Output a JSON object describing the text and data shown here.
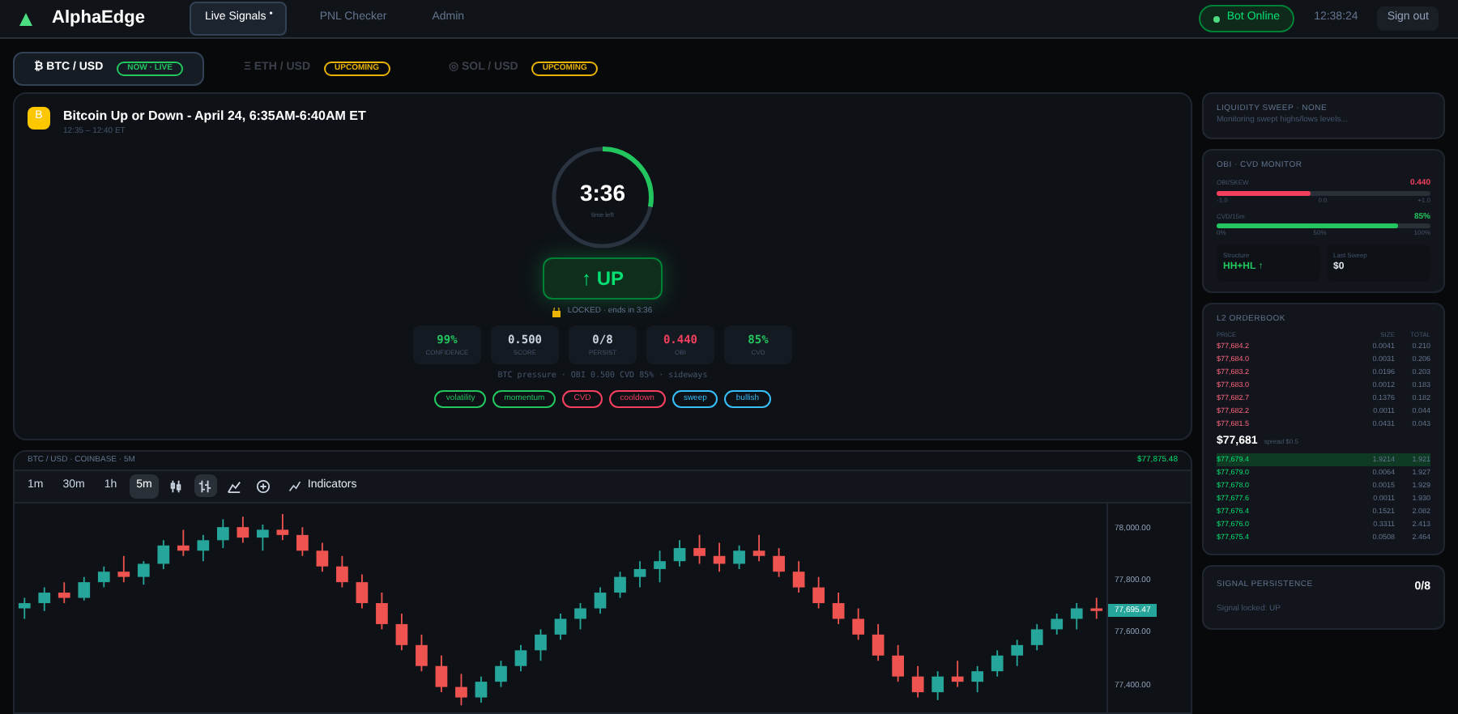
{
  "header": {
    "logo": "AlphaEdge",
    "nav": [
      {
        "label": "Live Signals",
        "selected": true,
        "badge": "•"
      },
      {
        "label": "PNL Checker",
        "selected": false
      },
      {
        "label": "Admin",
        "selected": false
      }
    ],
    "status": "Bot Online",
    "clock": "12:38:24",
    "sign_out": "Sign out"
  },
  "markets": [
    {
      "label": "₿ BTC / USD",
      "badge": "NOW · LIVE",
      "selected": true,
      "color": "#22c55e"
    },
    {
      "label": "Ξ ETH / USD",
      "badge": "UPCOMING",
      "selected": false,
      "color": "#eab308"
    },
    {
      "label": "◎ SOL / USD",
      "badge": "UPCOMING",
      "selected": false,
      "color": "#eab308"
    }
  ],
  "event": {
    "icon": "B",
    "title": "Bitcoin Up or Down - April 24, 6:35AM-6:40AM ET",
    "subtitle": "12:35 – 12:40 ET",
    "timer": "3:36",
    "timer_label": "time left",
    "level": 0.28,
    "signal": "↑ UP",
    "lock": "LOCKED · ends in 3:36",
    "stats": [
      {
        "value": "99%",
        "label": "CONFIDENCE",
        "color": "#22c55e"
      },
      {
        "value": "0.500",
        "label": "SCORE",
        "color": "#cbd5e1"
      },
      {
        "value": "0/8",
        "label": "PERSIST",
        "color": "#cbd5e1"
      },
      {
        "value": "0.440",
        "label": "OBI",
        "color": "#f43f5e"
      },
      {
        "value": "85%",
        "label": "CVD",
        "color": "#22c55e"
      }
    ],
    "pressure": "BTC pressure · OBI 0.500 CVD 85% · sideways",
    "tags": [
      {
        "label": "volatility",
        "color": "#22c55e"
      },
      {
        "label": "momentum",
        "color": "#22c55e"
      },
      {
        "label": "CVD",
        "color": "#f43f5e"
      },
      {
        "label": "cooldown",
        "color": "#f43f5e"
      },
      {
        "label": "sweep",
        "color": "#38bdf8"
      },
      {
        "label": "bullish",
        "color": "#38bdf8"
      }
    ]
  },
  "chart": {
    "price": "$77,875.48",
    "intervals": [
      {
        "label": "1m",
        "selected": false
      },
      {
        "label": "30m",
        "selected": false
      },
      {
        "label": "1h",
        "selected": false
      },
      {
        "label": "5m",
        "selected": true
      }
    ],
    "indicators": "Indicators",
    "chart_data": {
      "type": "candlestick",
      "title": "BTC / USD · COINBASE · 5M",
      "ohlc": [
        [
          77700,
          77740,
          77660,
          77720
        ],
        [
          77720,
          77780,
          77690,
          77760
        ],
        [
          77760,
          77800,
          77720,
          77740
        ],
        [
          77740,
          77820,
          77730,
          77800
        ],
        [
          77800,
          77860,
          77780,
          77840
        ],
        [
          77840,
          77900,
          77800,
          77820
        ],
        [
          77820,
          77880,
          77790,
          77870
        ],
        [
          77870,
          77960,
          77850,
          77940
        ],
        [
          77940,
          78000,
          77900,
          77920
        ],
        [
          77920,
          77980,
          77880,
          77960
        ],
        [
          77960,
          78040,
          77930,
          78010
        ],
        [
          78010,
          78050,
          77950,
          77970
        ],
        [
          77970,
          78020,
          77920,
          78000
        ],
        [
          78000,
          78060,
          77960,
          77980
        ],
        [
          77980,
          78010,
          77900,
          77920
        ],
        [
          77920,
          77950,
          77840,
          77860
        ],
        [
          77860,
          77900,
          77780,
          77800
        ],
        [
          77800,
          77830,
          77700,
          77720
        ],
        [
          77720,
          77760,
          77620,
          77640
        ],
        [
          77640,
          77680,
          77540,
          77560
        ],
        [
          77560,
          77600,
          77460,
          77480
        ],
        [
          77480,
          77520,
          77380,
          77400
        ],
        [
          77400,
          77450,
          77330,
          77360
        ],
        [
          77360,
          77440,
          77340,
          77420
        ],
        [
          77420,
          77500,
          77400,
          77480
        ],
        [
          77480,
          77560,
          77460,
          77540
        ],
        [
          77540,
          77620,
          77500,
          77600
        ],
        [
          77600,
          77680,
          77580,
          77660
        ],
        [
          77660,
          77720,
          77620,
          77700
        ],
        [
          77700,
          77780,
          77680,
          77760
        ],
        [
          77760,
          77840,
          77740,
          77820
        ],
        [
          77820,
          77880,
          77780,
          77850
        ],
        [
          77850,
          77920,
          77800,
          77880
        ],
        [
          77880,
          77960,
          77860,
          77930
        ],
        [
          77930,
          77980,
          77870,
          77900
        ],
        [
          77900,
          77950,
          77840,
          77870
        ],
        [
          77870,
          77940,
          77850,
          77920
        ],
        [
          77920,
          77980,
          77880,
          77900
        ],
        [
          77900,
          77930,
          77820,
          77840
        ],
        [
          77840,
          77880,
          77760,
          77780
        ],
        [
          77780,
          77820,
          77700,
          77720
        ],
        [
          77720,
          77760,
          77640,
          77660
        ],
        [
          77660,
          77700,
          77580,
          77600
        ],
        [
          77600,
          77640,
          77500,
          77520
        ],
        [
          77520,
          77560,
          77420,
          77440
        ],
        [
          77440,
          77480,
          77360,
          77380
        ],
        [
          77380,
          77460,
          77350,
          77440
        ],
        [
          77440,
          77500,
          77400,
          77420
        ],
        [
          77420,
          77480,
          77380,
          77460
        ],
        [
          77460,
          77540,
          77440,
          77520
        ],
        [
          77520,
          77580,
          77480,
          77560
        ],
        [
          77560,
          77640,
          77540,
          77620
        ],
        [
          77620,
          77680,
          77600,
          77660
        ],
        [
          77660,
          77720,
          77620,
          77700
        ],
        [
          77700,
          77740,
          77660,
          77690
        ]
      ],
      "ylim": [
        77300,
        78100
      ],
      "yticks": [
        {
          "value": 78000,
          "label": "78,000.00"
        },
        {
          "value": 77800,
          "label": "77,800.00"
        },
        {
          "value": 77600,
          "label": "77,600.00"
        },
        {
          "value": 77400,
          "label": "77,400.00"
        }
      ],
      "annotations": [
        "77,695.47"
      ]
    }
  },
  "liquidity": {
    "title": "LIQUIDITY SWEEP · NONE",
    "text": "Monitoring swept highs/lows levels..."
  },
  "monitor": {
    "title": "OBI · CVD MONITOR",
    "bars": [
      {
        "label": "OBI/SKEW",
        "reading": "0.440",
        "level": 0.44,
        "color": "#f43f5e",
        "ticks": [
          "-1.0",
          "0.0",
          "+1.0"
        ]
      },
      {
        "label": "CVD/15m",
        "reading": "85%",
        "level": 0.85,
        "color": "#22c55e",
        "ticks": [
          "0%",
          "50%",
          "100%"
        ]
      }
    ],
    "boxes": [
      {
        "label": "Structure",
        "value": "HH+HL ↑",
        "color": "#22c55e"
      },
      {
        "label": "Last Sweep",
        "value": "$0",
        "color": "#e2e8f0"
      }
    ]
  },
  "orderbook": {
    "title": "L2 ORDERBOOK",
    "columns": [
      "PRICE",
      "SIZE",
      "TOTAL"
    ],
    "asks": [
      [
        "$77,684.2",
        "0.0041",
        "0.210"
      ],
      [
        "$77,684.0",
        "0.0031",
        "0.206"
      ],
      [
        "$77,683.2",
        "0.0196",
        "0.203"
      ],
      [
        "$77,683.0",
        "0.0012",
        "0.183"
      ],
      [
        "$77,682.7",
        "0.1376",
        "0.182"
      ],
      [
        "$77,682.2",
        "0.0011",
        "0.044"
      ],
      [
        "$77,681.5",
        "0.0431",
        "0.043"
      ]
    ],
    "mid": "$77,681",
    "spread": "spread $0.5",
    "bids": [
      {
        "cells": [
          "$77,679.4",
          "1.9214",
          "1.921"
        ],
        "selected": true
      },
      {
        "cells": [
          "$77,679.0",
          "0.0064",
          "1.927"
        ],
        "selected": false
      },
      {
        "cells": [
          "$77,678.0",
          "0.0015",
          "1.929"
        ],
        "selected": false
      },
      {
        "cells": [
          "$77,677.6",
          "0.0011",
          "1.930"
        ],
        "selected": false
      },
      {
        "cells": [
          "$77,676.4",
          "0.1521",
          "2.082"
        ],
        "selected": false
      },
      {
        "cells": [
          "$77,676.0",
          "0.3311",
          "2.413"
        ],
        "selected": false
      },
      {
        "cells": [
          "$77,675.4",
          "0.0508",
          "2.464"
        ],
        "selected": false
      }
    ]
  },
  "persistence": {
    "title": "SIGNAL PERSISTENCE",
    "value": "0/8",
    "text": "Signal locked: UP"
  }
}
